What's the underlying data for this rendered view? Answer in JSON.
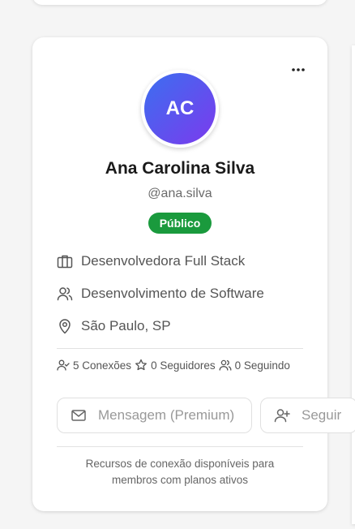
{
  "profile": {
    "initials": "AC",
    "name": "Ana Carolina Silva",
    "username": "@ana.silva",
    "visibility": "Público",
    "details": [
      {
        "icon": "briefcase-icon",
        "text": "Desenvolvedora Full Stack"
      },
      {
        "icon": "users-icon",
        "text": "Desenvolvimento de Software"
      },
      {
        "icon": "map-pin-icon",
        "text": "São Paulo, SP"
      }
    ],
    "stats": {
      "connections": "5 Conexões",
      "followers": "0 Seguidores",
      "following": "0 Seguindo"
    }
  },
  "actions": {
    "message_label": "Mensagem (Premium)",
    "follow_label": "Seguir"
  },
  "footer": {
    "line1": "Recursos de conexão disponíveis para",
    "line2": "membros com planos ativos"
  },
  "colors": {
    "badge": "#1a9a3d",
    "avatar_from": "#3b6ff0",
    "avatar_to": "#7c3aed"
  }
}
